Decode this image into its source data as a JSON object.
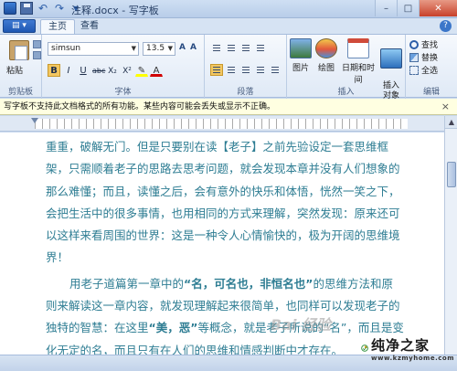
{
  "window": {
    "title": "注释.docx - 写字板",
    "close_glyph": "✕",
    "maximize_glyph": "□",
    "minimize_glyph": "–"
  },
  "quick_access": {
    "undo_glyph": "↶",
    "redo_glyph": "↷",
    "more_glyph": "▾"
  },
  "menu_button": {
    "label": "▤ ▾"
  },
  "tabs": [
    {
      "label": "主页",
      "active": true
    },
    {
      "label": "查看",
      "active": false
    }
  ],
  "help_glyph": "?",
  "ribbon": {
    "clipboard": {
      "paste_label": "粘贴",
      "group_label": "剪贴板"
    },
    "font": {
      "family": "simsun",
      "size": "13.5",
      "group_label": "字体",
      "buttons": [
        "B",
        "I",
        "U",
        "abc",
        "X₂",
        "X²",
        "✎",
        "A"
      ],
      "highlight_color": "#ffff00",
      "font_color": "#d00000"
    },
    "paragraph": {
      "group_label": "段落"
    },
    "insert": {
      "group_label": "插入",
      "items": [
        "图片",
        "绘图",
        "日期和时间",
        "插入\n对象"
      ]
    },
    "editing": {
      "group_label": "编辑",
      "items": [
        "查找",
        "替换",
        "全选"
      ]
    }
  },
  "infobar": {
    "message": "写字板不支持此文档格式的所有功能。某些内容可能会丢失或显示不正确。",
    "close_glyph": "×"
  },
  "document": {
    "paragraph1": "重重，破解无门。但是只要别在读【老子】之前先验设定一套思维框架，只需顺着老子的思路去思考问题，就会发现本章并没有人们想象的那么难懂；而且，读懂之后，会有意外的快乐和体悟，恍然一笑之下，会把生活中的很多事情，也用相同的方式来理解，突然发现：原来还可以这样来看周围的世界：这是一种令人心情愉快的，极为开阔的思维境界！",
    "paragraph2_a": "用老子道篇第一章中的",
    "paragraph2_b": "“名，可名也，非恒名也”",
    "paragraph2_c": "的思维方法和原则来解读这一章内容，就发现理解起来很简单，也同样可以发现老子的独特的智慧：在这里",
    "paragraph2_d": "“美，恶”",
    "paragraph2_e": "等概念，就是老子所说的“名”，而且是变化无定的名，而且只有在人们的思维和情感判断中才存在。",
    "text_color": "#2e7d93"
  },
  "scrollbar": {
    "up_glyph": "▲"
  },
  "watermark": {
    "baidu_text": "Bai  经验"
  },
  "logo": {
    "cn": "纯净之家",
    "en": "www.kzmyhome.com"
  }
}
